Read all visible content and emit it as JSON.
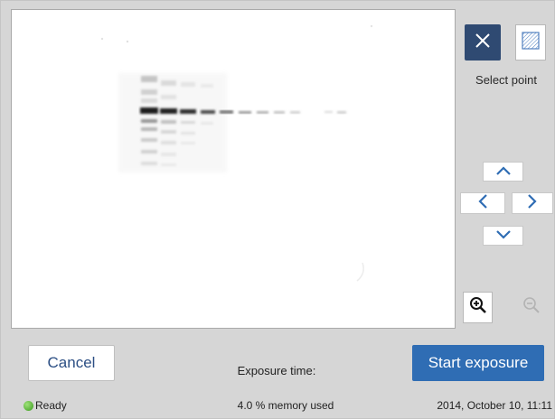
{
  "controls": {
    "close_icon": "close-icon",
    "region_icon": "hatched-square-icon",
    "select_point_label": "Select point",
    "nav_icons": [
      "chevron-up-icon",
      "chevron-left-icon",
      "chevron-right-icon",
      "chevron-down-icon"
    ],
    "zoom_in_icon": "zoom-in-icon",
    "zoom_out_icon": "zoom-out-icon"
  },
  "bottom": {
    "cancel_label": "Cancel",
    "exposure_label": "Exposure time:",
    "start_label": "Start exposure"
  },
  "status": {
    "state": "Ready",
    "memory": "4.0 % memory used",
    "datetime": "2014, October 10, 11:11"
  },
  "colors": {
    "accent_dark": "#2f4a72",
    "accent_primary": "#2f6db4",
    "link_text": "#2c4f84",
    "status_ok": "#4caf2a"
  }
}
